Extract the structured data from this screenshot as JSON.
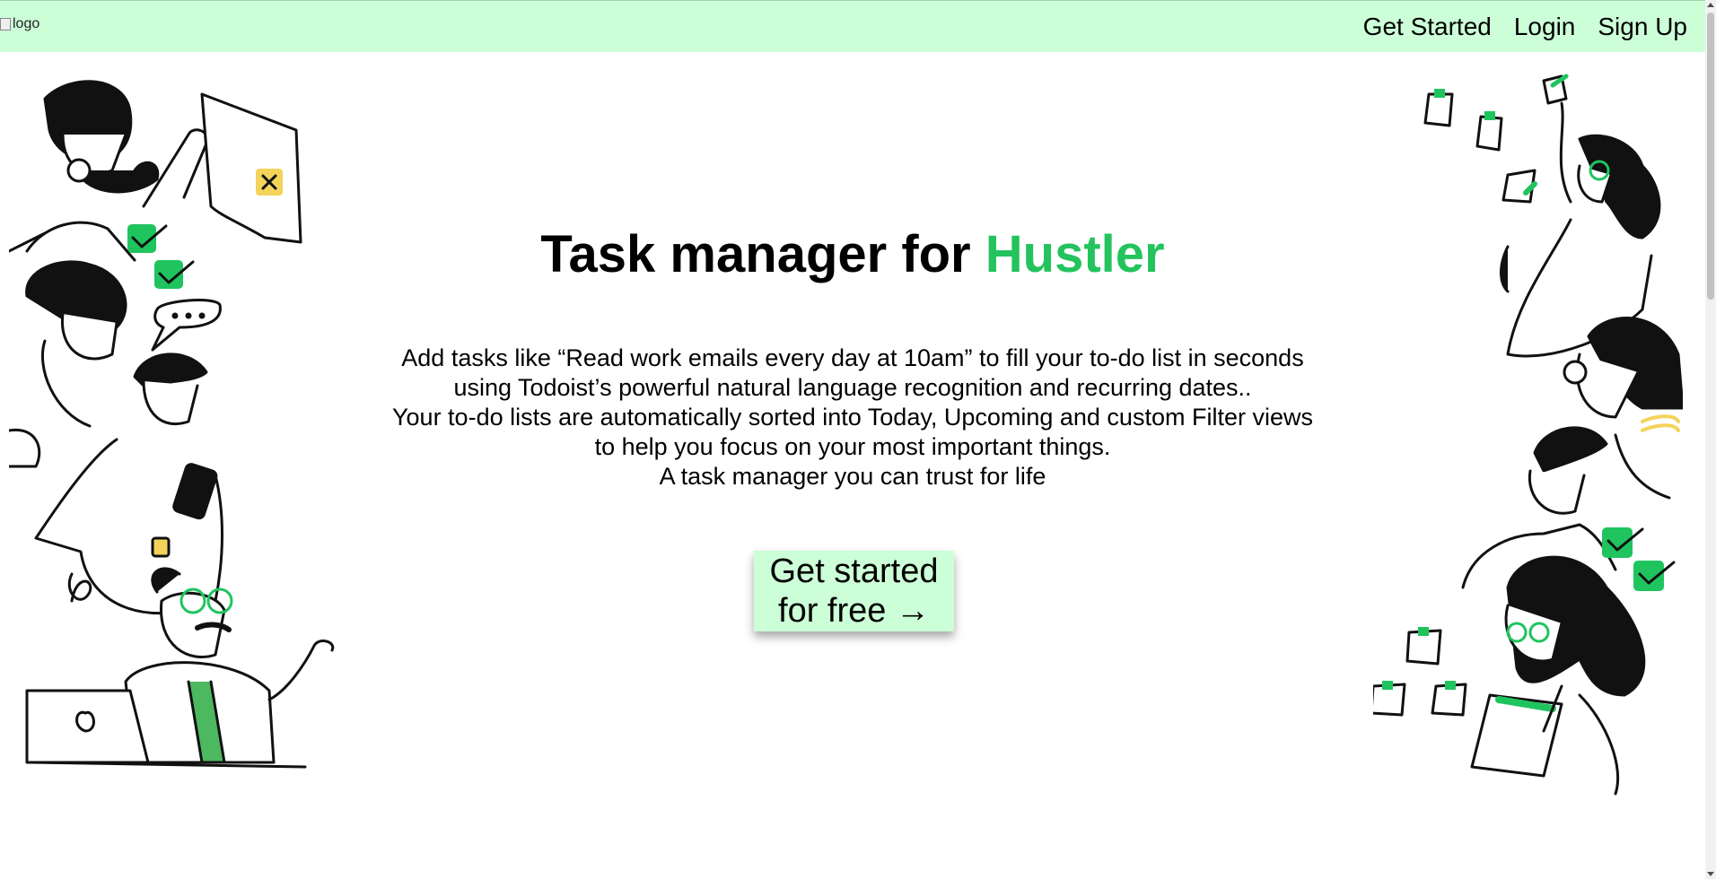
{
  "navbar": {
    "logo_alt": "logo",
    "links": [
      {
        "label": "Get Started"
      },
      {
        "label": "Login"
      },
      {
        "label": "Sign Up"
      }
    ]
  },
  "hero": {
    "title_main": "Task manager for ",
    "title_accent": "Hustler",
    "description_lines": [
      "Add tasks like “Read work emails every day at 10am” to fill your to-do list in seconds",
      "using Todoist’s powerful natural language recognition and recurring dates..",
      "Your to-do lists are automatically sorted into Today, Upcoming and custom Filter views",
      "to help you focus on your most important things.",
      "A task manager you can trust for life"
    ],
    "cta_line1": "Get started",
    "cta_line2": "for free →"
  },
  "colors": {
    "navbar_bg": "#ccffd8",
    "accent": "#24c35d",
    "illustration_green": "#1fc45e",
    "illustration_yellow": "#f3d35a"
  }
}
